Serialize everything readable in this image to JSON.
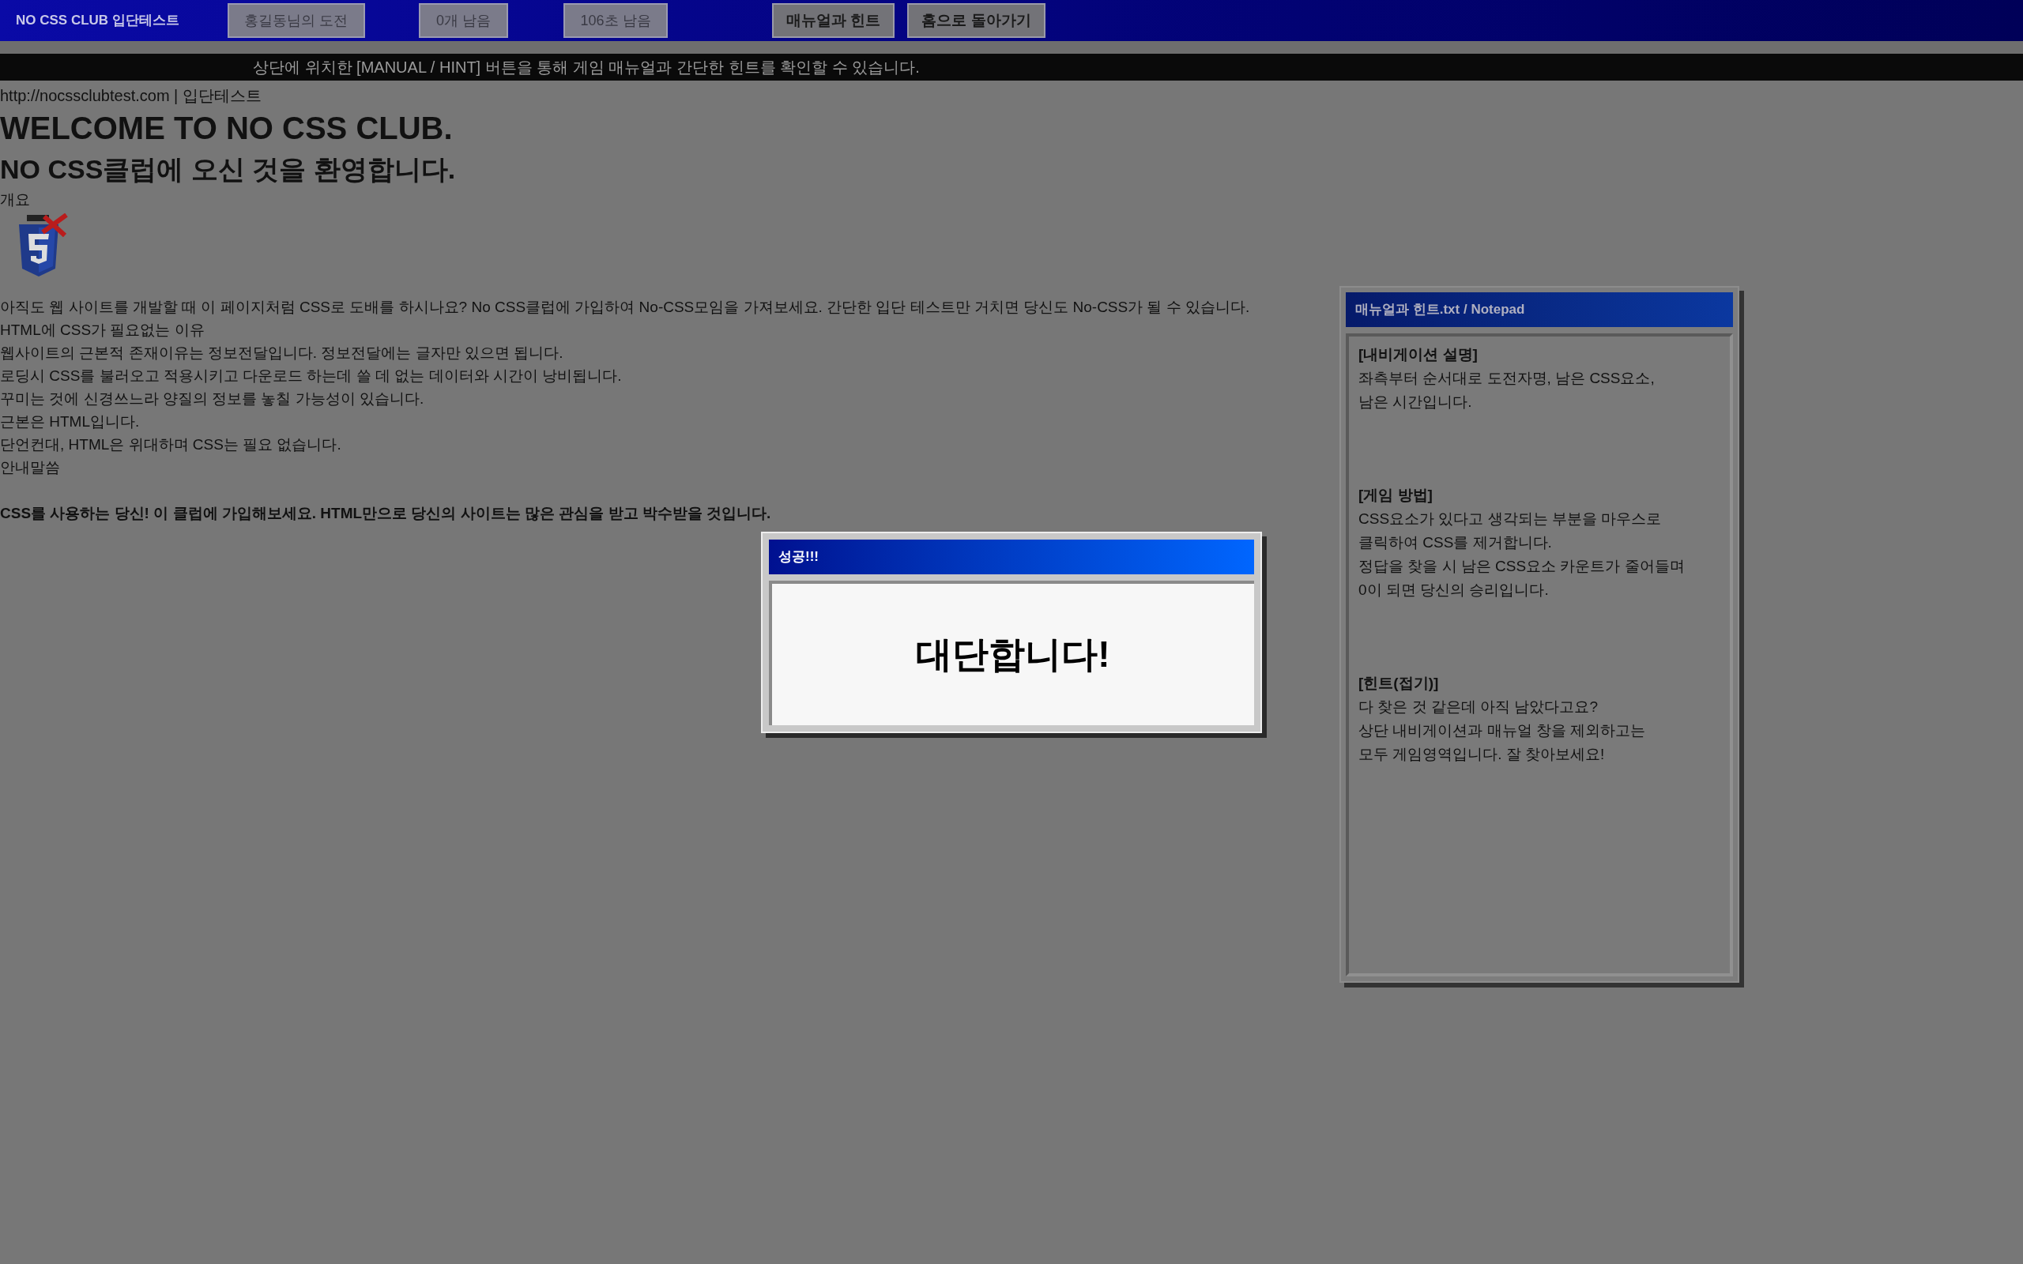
{
  "top_bar": {
    "title": "NO CSS CLUB 입단테스트",
    "fields": [
      "홍길동님의 도전",
      "0개 남음",
      "106초 남음"
    ],
    "buttons": [
      "매뉴얼과 힌트",
      "홈으로 돌아가기"
    ]
  },
  "banner": "상단에 위치한 [MANUAL / HINT] 버튼을 통해 게임 매뉴얼과 간단한 힌트를 확인할 수 있습니다.",
  "page": {
    "address": "http://nocssclubtest.com | 입단테스트",
    "heading": "WELCOME TO NO CSS CLUB.",
    "subheading": "NO CSS클럽에 오신 것을 환영합니다.",
    "overview_label": "개요",
    "lines": [
      "아직도 웹 사이트를 개발할 때 이 페이지처럼 CSS로 도배를 하시나요? No CSS클럽에 가입하여 No-CSS모임을 가져보세요. 간단한 입단 테스트만 거치면 당신도 No-CSS가 될 수 있습니다.",
      "HTML에 CSS가 필요없는 이유",
      "웹사이트의 근본적 존재이유는 정보전달입니다. 정보전달에는 글자만 있으면 됩니다.",
      "로딩시 CSS를 불러오고 적용시키고 다운로드 하는데 쓸 데 없는 데이터와 시간이 낭비됩니다.",
      "꾸미는 것에 신경쓰느라 양질의 정보를 놓칠 가능성이 있습니다.",
      "근본은 HTML입니다.",
      "단언컨대, HTML은 위대하며 CSS는 필요 없습니다.",
      "안내말씀"
    ],
    "closing": "CSS를 사용하는 당신! 이 클럽에 가입해보세요. HTML만으로 당신의 사이트는 많은 관심을 받고 박수받을 것입니다."
  },
  "notepad": {
    "title": "매뉴얼과 힌트.txt / Notepad",
    "sections": [
      {
        "heading": "[내비게이션 설명]",
        "lines": [
          "좌측부터 순서대로 도전자명, 남은 CSS요소,",
          "남은 시간입니다."
        ]
      },
      {
        "heading": "[게임 방법]",
        "lines": [
          "CSS요소가 있다고 생각되는 부분을 마우스로",
          "클릭하여 CSS를 제거합니다.",
          "정답을 찾을 시 남은 CSS요소 카운트가 줄어들며",
          "0이 되면 당신의 승리입니다."
        ]
      },
      {
        "heading": "[힌트(접기)]",
        "lines": [
          "다 찾은 것 같은데 아직 남았다고요?",
          "상단 내비게이션과 매뉴얼 창을 제외하고는",
          "모두 게임영역입니다. 잘 찾아보세요!"
        ]
      }
    ]
  },
  "dialog": {
    "title": "성공!!!",
    "message": "대단합니다!"
  }
}
